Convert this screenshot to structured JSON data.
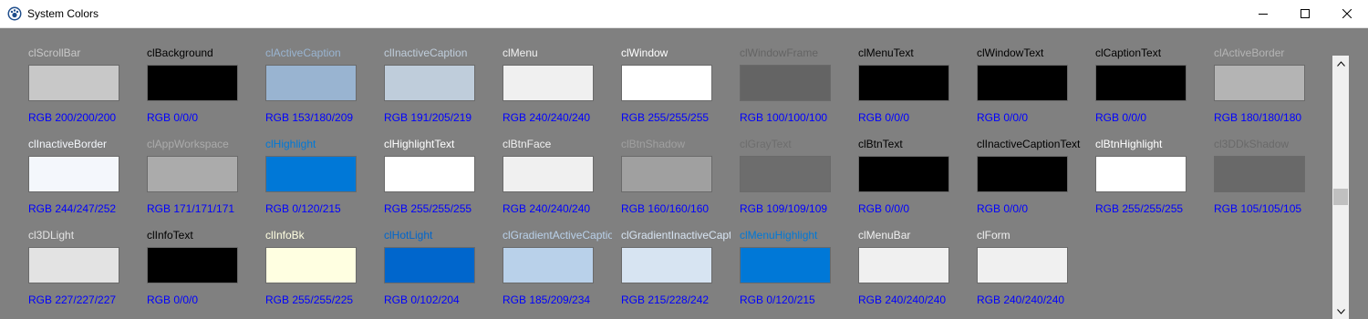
{
  "window": {
    "title": "System Colors"
  },
  "colors": [
    {
      "name": "clScrollBar",
      "rgb": "RGB 200/200/200",
      "hex": "#c8c8c8",
      "label_color": "#c8c8c8"
    },
    {
      "name": "clBackground",
      "rgb": "RGB 0/0/0",
      "hex": "#000000",
      "label_color": "#000000"
    },
    {
      "name": "clActiveCaption",
      "rgb": "RGB 153/180/209",
      "hex": "#99b4d1",
      "label_color": "#99b4d1"
    },
    {
      "name": "clInactiveCaption",
      "rgb": "RGB 191/205/219",
      "hex": "#bfcddb",
      "label_color": "#bfcddb"
    },
    {
      "name": "clMenu",
      "rgb": "RGB 240/240/240",
      "hex": "#f0f0f0",
      "label_color": "#f0f0f0"
    },
    {
      "name": "clWindow",
      "rgb": "RGB 255/255/255",
      "hex": "#ffffff",
      "label_color": "#ffffff"
    },
    {
      "name": "clWindowFrame",
      "rgb": "RGB 100/100/100",
      "hex": "#646464",
      "label_color": "#646464"
    },
    {
      "name": "clMenuText",
      "rgb": "RGB 0/0/0",
      "hex": "#000000",
      "label_color": "#000000"
    },
    {
      "name": "clWindowText",
      "rgb": "RGB 0/0/0",
      "hex": "#000000",
      "label_color": "#000000"
    },
    {
      "name": "clCaptionText",
      "rgb": "RGB 0/0/0",
      "hex": "#000000",
      "label_color": "#000000"
    },
    {
      "name": "clActiveBorder",
      "rgb": "RGB 180/180/180",
      "hex": "#b4b4b4",
      "label_color": "#b4b4b4"
    },
    {
      "name": "clInactiveBorder",
      "rgb": "RGB 244/247/252",
      "hex": "#f4f7fc",
      "label_color": "#f4f7fc"
    },
    {
      "name": "clAppWorkspace",
      "rgb": "RGB 171/171/171",
      "hex": "#ababab",
      "label_color": "#ababab"
    },
    {
      "name": "clHighlight",
      "rgb": "RGB 0/120/215",
      "hex": "#0078d7",
      "label_color": "#0078d7"
    },
    {
      "name": "clHighlightText",
      "rgb": "RGB 255/255/255",
      "hex": "#ffffff",
      "label_color": "#ffffff"
    },
    {
      "name": "clBtnFace",
      "rgb": "RGB 240/240/240",
      "hex": "#f0f0f0",
      "label_color": "#f0f0f0"
    },
    {
      "name": "clBtnShadow",
      "rgb": "RGB 160/160/160",
      "hex": "#a0a0a0",
      "label_color": "#a0a0a0"
    },
    {
      "name": "clGrayText",
      "rgb": "RGB 109/109/109",
      "hex": "#6d6d6d",
      "label_color": "#6d6d6d"
    },
    {
      "name": "clBtnText",
      "rgb": "RGB 0/0/0",
      "hex": "#000000",
      "label_color": "#000000"
    },
    {
      "name": "clInactiveCaptionText",
      "rgb": "RGB 0/0/0",
      "hex": "#000000",
      "label_color": "#000000"
    },
    {
      "name": "clBtnHighlight",
      "rgb": "RGB 255/255/255",
      "hex": "#ffffff",
      "label_color": "#ffffff"
    },
    {
      "name": "cl3DDkShadow",
      "rgb": "RGB 105/105/105",
      "hex": "#696969",
      "label_color": "#696969"
    },
    {
      "name": "cl3DLight",
      "rgb": "RGB 227/227/227",
      "hex": "#e3e3e3",
      "label_color": "#e3e3e3"
    },
    {
      "name": "clInfoText",
      "rgb": "RGB 0/0/0",
      "hex": "#000000",
      "label_color": "#000000"
    },
    {
      "name": "clInfoBk",
      "rgb": "RGB 255/255/225",
      "hex": "#ffffe1",
      "label_color": "#ffffe1"
    },
    {
      "name": "clHotLight",
      "rgb": "RGB 0/102/204",
      "hex": "#0066cc",
      "label_color": "#0066cc"
    },
    {
      "name": "clGradientActiveCaption",
      "rgb": "RGB 185/209/234",
      "hex": "#b9d1ea",
      "label_color": "#b9d1ea"
    },
    {
      "name": "clGradientInactiveCaption",
      "rgb": "RGB 215/228/242",
      "hex": "#d7e4f2",
      "label_color": "#d7e4f2"
    },
    {
      "name": "clMenuHighlight",
      "rgb": "RGB 0/120/215",
      "hex": "#0078d7",
      "label_color": "#0078d7"
    },
    {
      "name": "clMenuBar",
      "rgb": "RGB 240/240/240",
      "hex": "#f0f0f0",
      "label_color": "#f0f0f0"
    },
    {
      "name": "clForm",
      "rgb": "RGB 240/240/240",
      "hex": "#f0f0f0",
      "label_color": "#f0f0f0"
    }
  ]
}
